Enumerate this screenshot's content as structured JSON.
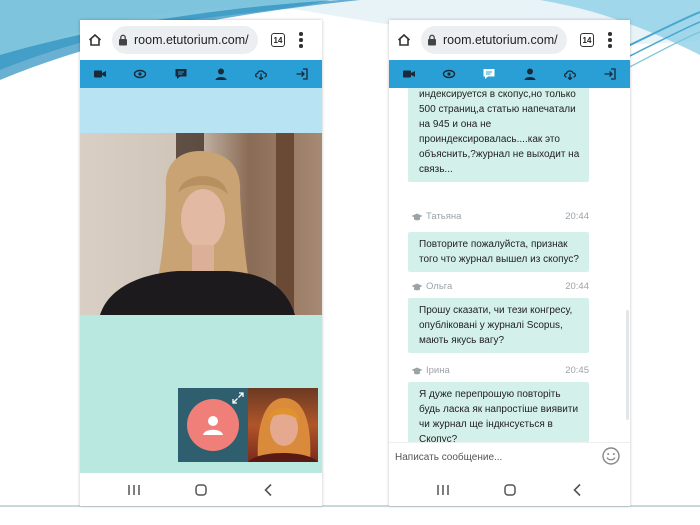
{
  "colors": {
    "toolbar": "#2a9fd6",
    "chat_bubble": "#d4f0ea",
    "mint_area": "#b9e8e0",
    "light_strip": "#b7e3f2",
    "avatar": "#f07f7a"
  },
  "left_phone": {
    "browser": {
      "url": "room.etutorium.com/",
      "tab_count": "14"
    },
    "toolbar_icons": [
      "video-icon",
      "eye-icon",
      "chat-icon",
      "user-icon",
      "cloud-download-icon",
      "exit-icon"
    ],
    "nav_icons": [
      "recent-apps-icon",
      "home-icon",
      "back-icon"
    ]
  },
  "right_phone": {
    "browser": {
      "url": "room.etutorium.com/",
      "tab_count": "14"
    },
    "toolbar_icons": [
      "video-icon",
      "eye-icon",
      "chat-icon",
      "user-icon",
      "cloud-download-icon",
      "exit-icon"
    ],
    "messages": [
      {
        "author": "",
        "time": "",
        "text": "индексируется в скопус,но только 500 страниц,а статью напечатали на 945 и она не проиндексировалась....как это объяснить,?журнал не выходит на связь..."
      },
      {
        "author": "Татьяна",
        "time": "20:44",
        "text": "Повторите пожалуйста, признак того что журнал вышел из скопус?"
      },
      {
        "author": "Ольга",
        "time": "20:44",
        "text": "Прошу сказати, чи тези конгресу, опубліковані у журналі Scopus, мають якусь вагу?"
      },
      {
        "author": "Ірина",
        "time": "20:45",
        "text": "Я дуже перепрошую повторіть будь ласка як напростіше виявити чи журнал ще індкнсується в Скопус?"
      }
    ],
    "input": {
      "placeholder": "Написать сообщение..."
    },
    "nav_icons": [
      "recent-apps-icon",
      "home-icon",
      "back-icon"
    ]
  }
}
